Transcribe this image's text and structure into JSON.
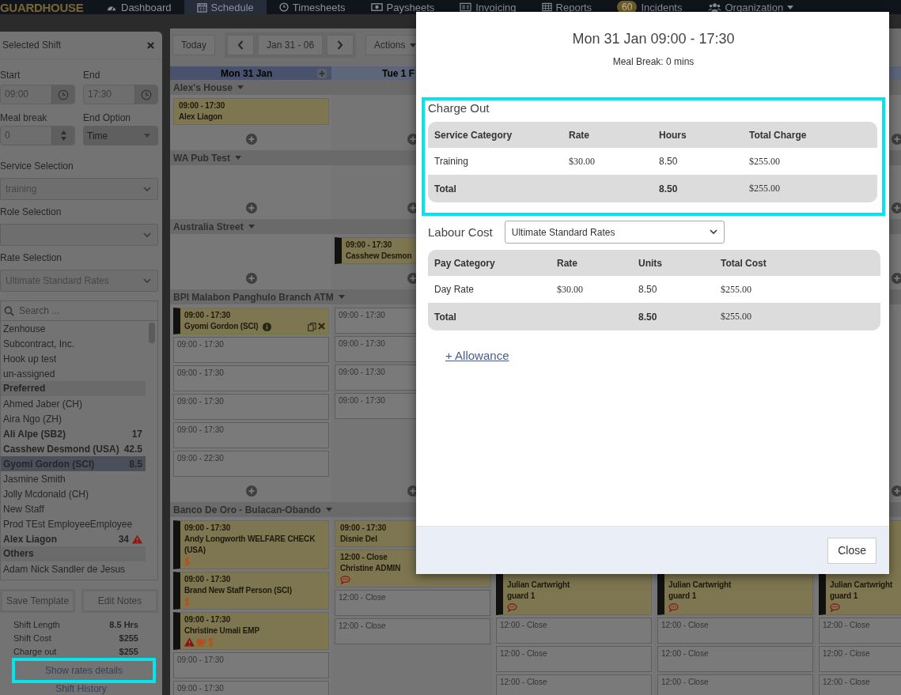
{
  "nav": {
    "logo": "GUARDHOUSE",
    "items": [
      {
        "label": "Dashboard",
        "selected": false
      },
      {
        "label": "Schedule",
        "selected": true
      },
      {
        "label": "Timesheets",
        "selected": false
      },
      {
        "label": "Paysheets",
        "selected": false
      },
      {
        "label": "Invoicing",
        "selected": false
      },
      {
        "label": "Reports",
        "selected": false
      },
      {
        "label": "Incidents",
        "badge": "60",
        "selected": false
      },
      {
        "label": "Organization",
        "dropdown": true,
        "selected": false
      }
    ]
  },
  "panel": {
    "title": "Selected Shift",
    "start": {
      "label": "Start",
      "value": "09:00"
    },
    "end": {
      "label": "End",
      "value": "17:30"
    },
    "meal_break": {
      "label": "Meal break",
      "value": "0"
    },
    "end_option": {
      "label": "End Option",
      "value": "Time"
    },
    "selects": [
      {
        "label": "Service Selection",
        "value": "training"
      },
      {
        "label": "Role Selection"
      },
      {
        "label": "Rate Selection",
        "value": "Ultimate Standard Rates"
      }
    ],
    "search": {
      "placeholder": "Search ..."
    },
    "staff_list": [
      {
        "kind": "staff",
        "name": "Zenhouse",
        "bold": false,
        "warning": false,
        "selected": false
      },
      {
        "kind": "staff",
        "name": "Subcontract, Inc.",
        "bold": false,
        "warning": false,
        "selected": false
      },
      {
        "kind": "staff",
        "name": "Hook up test",
        "bold": false,
        "warning": false,
        "selected": false
      },
      {
        "kind": "staff",
        "name": "un-assigned",
        "bold": false,
        "warning": false,
        "selected": false
      },
      {
        "kind": "group",
        "name": "Preferred"
      },
      {
        "kind": "staff",
        "name": "Ahmed Jaber (CH)",
        "bold": false,
        "warning": false,
        "selected": false
      },
      {
        "kind": "staff",
        "name": "Aira Ngo (ZH)",
        "bold": false,
        "warning": false,
        "selected": false
      },
      {
        "kind": "staff",
        "name": "Ali Alpe (SB2)",
        "hours": "17",
        "bold": true,
        "warning": false,
        "selected": false
      },
      {
        "kind": "staff",
        "name": "Casshew Desmond (USA)",
        "hours": "42.5",
        "bold": true,
        "warning": false,
        "selected": false
      },
      {
        "kind": "staff",
        "name": "Gyomi Gordon (SCI)",
        "hours": "8.5",
        "bold": true,
        "warning": false,
        "selected": true
      },
      {
        "kind": "staff",
        "name": "Jasmine Smith",
        "bold": false,
        "warning": false,
        "selected": false
      },
      {
        "kind": "staff",
        "name": "Jolly Mcdonald (CH)",
        "bold": false,
        "warning": false,
        "selected": false
      },
      {
        "kind": "staff",
        "name": "New Staff",
        "bold": false,
        "warning": false,
        "selected": false
      },
      {
        "kind": "staff",
        "name": "Prod TEst EmployeeEmployee",
        "bold": false,
        "warning": false,
        "selected": false
      },
      {
        "kind": "staff",
        "name": "Alex Liagon",
        "hours": "34",
        "bold": true,
        "warning": true,
        "selected": false
      },
      {
        "kind": "group",
        "name": "Others"
      },
      {
        "kind": "staff",
        "name": "Adam Nick Sandler de Jesus",
        "bold": false,
        "warning": false,
        "selected": false
      }
    ],
    "buttons": [
      "Save Template",
      "Edit Notes"
    ],
    "stats": [
      {
        "label": "Shift Length",
        "value": "8.5 Hrs"
      },
      {
        "label": "Shift Cost",
        "value": "$255"
      },
      {
        "label": "Charge out",
        "value": "$255"
      }
    ],
    "rates_link": {
      "label": "Show rates details",
      "highlighted": true
    },
    "history_link": "Shift History"
  },
  "schedule": {
    "toolbar": {
      "today": "Today",
      "range": "Jan 31 - 06",
      "actions": "Actions"
    },
    "days": [
      {
        "label": "Mon 31 Jan",
        "selected": true
      },
      {
        "label": "Tue 1 F",
        "selected": false
      }
    ],
    "sites": [
      {
        "name": "Alex's House",
        "cells": [
          {
            "add": true,
            "cards": [
              {
                "kind": "shift",
                "time": "09:00 - 17:30",
                "name": "Alex Liagon",
                "flag": false,
                "selected": false
              }
            ]
          },
          {
            "add": true
          },
          null,
          null,
          {
            "add": true
          }
        ]
      },
      {
        "name": "WA Pub Test",
        "cells": [
          {
            "add": true
          },
          {
            "add": true
          },
          null,
          null,
          {
            "add": true
          }
        ]
      },
      {
        "name": "Australia Street",
        "cells": [
          {
            "add": true
          },
          {
            "add": true,
            "cards": [
              {
                "kind": "shift",
                "time": "09:00 - 17:30",
                "name": "Casshew Desmon",
                "flag": true,
                "selected": false
              }
            ]
          },
          null,
          null,
          {
            "add": true
          }
        ]
      },
      {
        "name": "BPI Malabon Panghulo Branch ATM",
        "cells": [
          {
            "add": true,
            "cards": [
              {
                "kind": "shift",
                "time": "09:00 - 17:30",
                "name": "Gyomi Gordon (SCI)",
                "flag": true,
                "selected": true,
                "info": true
              },
              {
                "kind": "open",
                "time": "09:00 - 17:30",
                "flag": false,
                "selected": false
              },
              {
                "kind": "open",
                "time": "09:00 - 17:30",
                "flag": false,
                "selected": false
              },
              {
                "kind": "open",
                "time": "09:00 - 17:30",
                "flag": false,
                "selected": false
              },
              {
                "kind": "open",
                "time": "09:00 - 17:30",
                "flag": false,
                "selected": false
              },
              {
                "kind": "open",
                "time": "09:00 - 22:30",
                "flag": false,
                "selected": false
              }
            ]
          },
          {
            "add": true,
            "cards": [
              {
                "kind": "open",
                "time": "09:00 - 17:30",
                "flag": false,
                "selected": false
              },
              {
                "kind": "open",
                "time": "09:00 - 17:30",
                "flag": false,
                "selected": false
              },
              {
                "kind": "open",
                "time": "09:00 - 17:30",
                "flag": false,
                "selected": false
              },
              {
                "kind": "open",
                "time": "09:00 - 17:30",
                "flag": false,
                "selected": false
              }
            ]
          },
          null,
          null,
          {
            "add": true
          }
        ]
      },
      {
        "name": "Banco De Oro - Bulacan-Obando",
        "cells": [
          {
            "cards": [
              {
                "kind": "shift",
                "time": "09:00 - 17:30",
                "name": "Andy Longworth WELFARE CHECK (USA)",
                "flag": true,
                "selected": false,
                "rate": true
              },
              {
                "kind": "shift",
                "time": "09:00 - 17:30",
                "name": "Brand New Staff Person (SCI)",
                "flag": true,
                "selected": false,
                "rate": true
              },
              {
                "kind": "shift",
                "time": "09:00 - 17:30",
                "name": "Christine Umali EMP",
                "flag": true,
                "selected": false,
                "alert": true,
                "meal": true,
                "rate": true
              },
              {
                "kind": "open",
                "time": "09:00 - 17:30",
                "flag": false,
                "selected": false
              },
              {
                "kind": "open",
                "time": "09:00 - 17:30",
                "flag": false,
                "selected": false
              }
            ]
          },
          {
            "cards": [
              {
                "kind": "shift",
                "time": "09:00 - 17:30",
                "name": "Disnie Del",
                "flag": false,
                "selected": false
              },
              {
                "kind": "shift",
                "time": "12:00 - Close",
                "name": "Christine ADMIN",
                "flag": false,
                "selected": false,
                "comment": true
              },
              {
                "kind": "open",
                "time": "12:00 - Close",
                "flag": false,
                "selected": false
              },
              {
                "kind": "open",
                "time": "12:00 - Close",
                "flag": false,
                "selected": false
              }
            ]
          },
          {
            "cards": [
              {
                "kind": "shift",
                "name": "Julian Cartwright",
                "role": "guard 1",
                "flag": true,
                "selected": false,
                "comment": true
              },
              {
                "kind": "open",
                "time": "12:00 - Close",
                "flag": false,
                "selected": false
              },
              {
                "kind": "open",
                "time": "12:00 - Close",
                "flag": false,
                "selected": false
              },
              {
                "kind": "open",
                "time": "12:00 - Close",
                "flag": false,
                "selected": false
              }
            ]
          },
          {
            "cards": [
              {
                "kind": "shift",
                "name": "Julian Cartwright",
                "role": "guard 1",
                "flag": true,
                "selected": false,
                "comment": true
              },
              {
                "kind": "open",
                "time": "12:00 - Close",
                "flag": false,
                "selected": false
              },
              {
                "kind": "open",
                "time": "12:00 - Close",
                "flag": false,
                "selected": false
              },
              {
                "kind": "open",
                "time": "12:00 - Close",
                "flag": false,
                "selected": false
              }
            ]
          },
          {
            "cards": [
              {
                "kind": "shift",
                "name": "Julian Cartwright",
                "role": "guard 1",
                "flag": true,
                "selected": false,
                "comment": true
              },
              {
                "kind": "open",
                "time": "12:00 - Close",
                "flag": false,
                "selected": false
              },
              {
                "kind": "open",
                "time": "12:00 - Close",
                "flag": false,
                "selected": false
              },
              {
                "kind": "open",
                "time": "12:00 - Close",
                "flag": false,
                "selected": false
              }
            ]
          }
        ]
      }
    ]
  },
  "modal": {
    "title": "Mon 31 Jan 09:00 - 17:30",
    "subtitle": "Meal Break: 0 mins",
    "charge_out": {
      "title": "Charge Out",
      "highlighted": true,
      "columns": [
        "Service Category",
        "Rate",
        "Hours",
        "Total Charge"
      ],
      "rows": [
        [
          "Training",
          "$30.00",
          "8.50",
          "$255.00"
        ]
      ],
      "total": {
        "label": "Total",
        "quantity": "8.50",
        "amount": "$255.00"
      }
    },
    "labour_cost": {
      "title": "Labour Cost",
      "rate_select": "Ultimate Standard Rates",
      "columns": [
        "Pay Category",
        "Rate",
        "Units",
        "Total Cost"
      ],
      "rows": [
        [
          "Day Rate",
          "$30.00",
          "8.50",
          "$255.00"
        ]
      ],
      "total": {
        "label": "Total",
        "quantity": "8.50",
        "amount": "$255.00"
      }
    },
    "allowance_link": "+ Allowance",
    "close": "Close"
  }
}
